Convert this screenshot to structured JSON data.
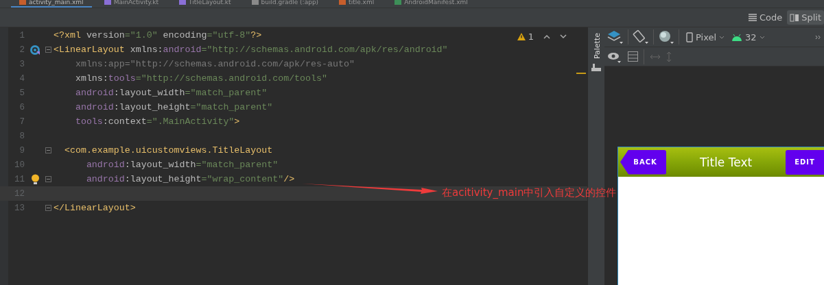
{
  "file_tabs": [
    {
      "label": "activity_main.xml",
      "kind": "xml",
      "selected": true
    },
    {
      "label": "MainActivity.kt",
      "kind": "kotlin",
      "selected": false
    },
    {
      "label": "TitleLayout.kt",
      "kind": "kotlin",
      "selected": false
    },
    {
      "label": "build.gradle (:app)",
      "kind": "gradle",
      "selected": false
    },
    {
      "label": "title.xml",
      "kind": "xml",
      "selected": false
    },
    {
      "label": "AndroidManifest.xml",
      "kind": "manifest",
      "selected": false
    }
  ],
  "view_modes": [
    {
      "label": "Code",
      "selected": false
    },
    {
      "label": "Split",
      "selected": true
    }
  ],
  "editor": {
    "warnings": "1",
    "lines": [
      {
        "number": "1",
        "current": false,
        "kind": "plain",
        "fold": false,
        "tokens": [
          {
            "kind": "tag",
            "text": "<?xml "
          },
          {
            "kind": "name",
            "text": "version"
          },
          {
            "kind": "str",
            "text": "=\"1.0\" "
          },
          {
            "kind": "name",
            "text": "encoding"
          },
          {
            "kind": "str",
            "text": "=\"utf-8\""
          },
          {
            "kind": "tag",
            "text": "?>"
          }
        ]
      },
      {
        "number": "2",
        "current": false,
        "kind": "activity",
        "fold": true,
        "tokens": [
          {
            "kind": "tag",
            "text": "<LinearLayout "
          },
          {
            "kind": "name",
            "text": "xmlns:"
          },
          {
            "kind": "ns",
            "text": "android"
          },
          {
            "kind": "str",
            "text": "=\"http://schemas.android.com/apk/res/android\""
          }
        ]
      },
      {
        "number": "3",
        "current": false,
        "kind": "plain",
        "fold": false,
        "tokens": [
          {
            "kind": "dim",
            "text": "    xmlns:app=\"http://schemas.android.com/apk/res-auto\""
          }
        ]
      },
      {
        "number": "4",
        "current": false,
        "kind": "plain",
        "fold": false,
        "tokens": [
          {
            "kind": "name",
            "text": "    xmlns:"
          },
          {
            "kind": "ns",
            "text": "tools"
          },
          {
            "kind": "str",
            "text": "=\"http://schemas.android.com/tools\""
          }
        ]
      },
      {
        "number": "5",
        "current": false,
        "kind": "plain",
        "fold": false,
        "tokens": [
          {
            "kind": "ns",
            "text": "    android"
          },
          {
            "kind": "name",
            "text": ":layout_width"
          },
          {
            "kind": "str",
            "text": "=\"match_parent\""
          }
        ]
      },
      {
        "number": "6",
        "current": false,
        "kind": "plain",
        "fold": false,
        "tokens": [
          {
            "kind": "ns",
            "text": "    android"
          },
          {
            "kind": "name",
            "text": ":layout_height"
          },
          {
            "kind": "str",
            "text": "=\"match_parent\""
          }
        ]
      },
      {
        "number": "7",
        "current": false,
        "kind": "plain",
        "fold": false,
        "tokens": [
          {
            "kind": "ns",
            "text": "    tools"
          },
          {
            "kind": "name",
            "text": ":context"
          },
          {
            "kind": "str",
            "text": "=\".MainActivity\""
          },
          {
            "kind": "tag",
            "text": ">"
          }
        ]
      },
      {
        "number": "8",
        "current": false,
        "kind": "plain",
        "fold": false
      },
      {
        "number": "9",
        "current": false,
        "kind": "plain",
        "fold": true,
        "tokens": [
          {
            "kind": "tag",
            "text": "  <com.example.uicustomviews.TitleLayout"
          }
        ]
      },
      {
        "number": "10",
        "current": false,
        "kind": "plain",
        "fold": false,
        "tokens": [
          {
            "kind": "ns",
            "text": "      android"
          },
          {
            "kind": "name",
            "text": ":layout_width"
          },
          {
            "kind": "str",
            "text": "=\"match_parent\""
          }
        ]
      },
      {
        "number": "11",
        "current": false,
        "kind": "bulb",
        "fold": true,
        "tokens": [
          {
            "kind": "ns",
            "text": "      android"
          },
          {
            "kind": "name",
            "text": ":layout_height"
          },
          {
            "kind": "str",
            "text": "=\"wrap_content\""
          },
          {
            "kind": "tag",
            "text": "/>"
          }
        ]
      },
      {
        "number": "12",
        "current": true,
        "kind": "plain",
        "fold": false
      },
      {
        "number": "13",
        "current": false,
        "kind": "plain",
        "fold": true,
        "tokens": [
          {
            "kind": "tag",
            "text": "</LinearLayout>"
          }
        ]
      }
    ]
  },
  "annotation": {
    "text": "在acitivity_main中引入自定义的控件"
  },
  "palette": {
    "label": "Palette"
  },
  "design_toolbar": {
    "device": "Pixel",
    "api": "32"
  },
  "preview": {
    "back": "BACK",
    "title": "Title Text",
    "edit": "EDIT"
  }
}
